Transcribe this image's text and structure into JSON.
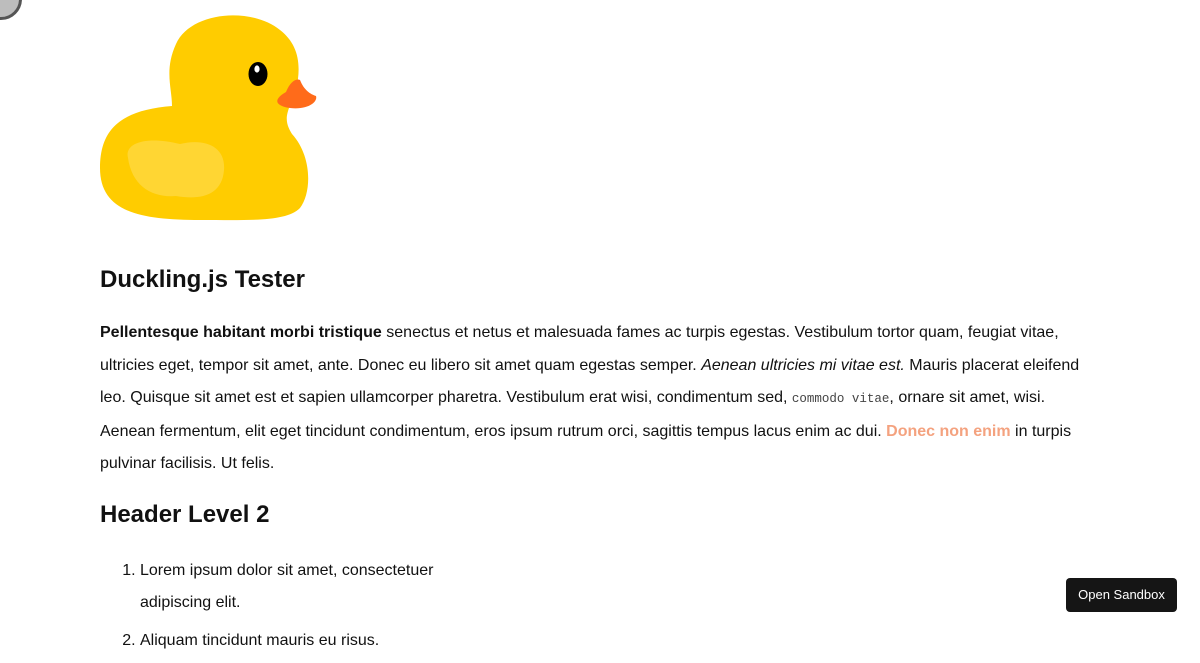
{
  "logo": {
    "icon": "rubber-duck-icon",
    "colors": {
      "body": "#ffcc00",
      "wing": "#ffd633",
      "beak": "#ff6b1a",
      "eye": "#000000"
    }
  },
  "heading": "Duckling.js Tester",
  "paragraph": {
    "bold": "Pellentesque habitant morbi tristique",
    "text1": " senectus et netus et malesuada fames ac turpis egestas. Vestibulum tortor quam, feugiat vitae, ultricies eget, tempor sit amet, ante. Donec eu libero sit amet quam egestas semper. ",
    "italic": "Aenean ultricies mi vitae est.",
    "text2": " Mauris placerat eleifend leo. Quisque sit amet est et sapien ullamcorper pharetra. Vestibulum erat wisi, condimentum sed, ",
    "code": "commodo vitae",
    "text3": ", ornare sit amet, wisi. Aenean fermentum, elit eget tincidunt condimentum, eros ipsum rutrum orci, sagittis tempus lacus enim ac dui. ",
    "link": "Donec non enim",
    "text4": " in turpis pulvinar facilisis. Ut felis."
  },
  "subheading": "Header Level 2",
  "list": [
    "Lorem ipsum dolor sit amet, consectetuer adipiscing elit.",
    "Aliquam tincidunt mauris eu risus."
  ],
  "sandbox_button": "Open Sandbox",
  "colors": {
    "link": "#f4a27f",
    "button_bg": "#151515"
  }
}
